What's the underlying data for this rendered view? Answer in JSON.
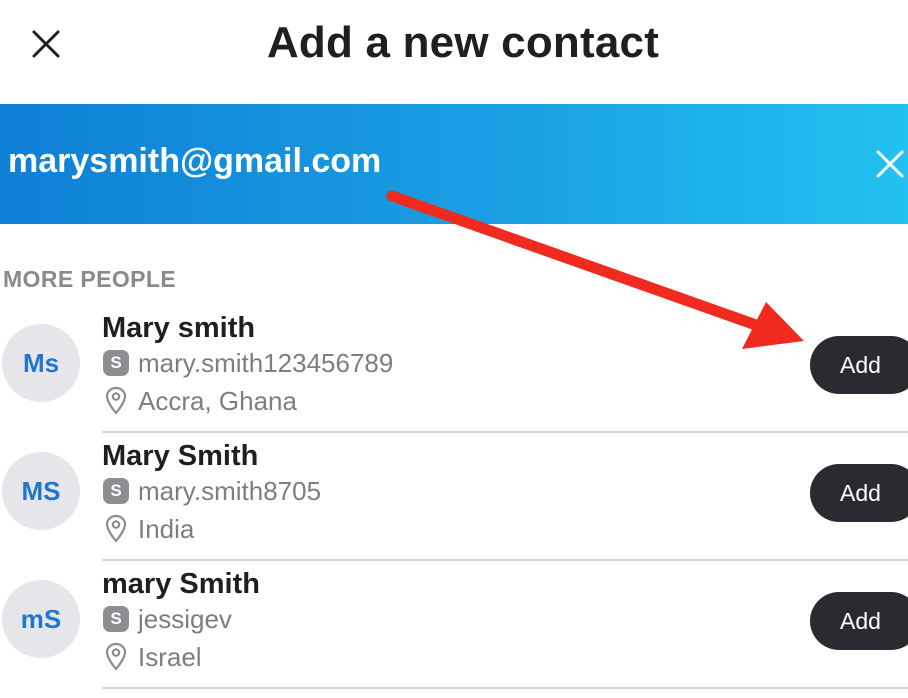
{
  "header": {
    "title": "Add a new contact"
  },
  "search": {
    "value": "marysmith@gmail.com"
  },
  "section": {
    "heading": "MORE PEOPLE"
  },
  "contacts": [
    {
      "initials": "Ms",
      "name": "Mary smith",
      "username": "mary.smith123456789",
      "location": "Accra, Ghana",
      "add_label": "Add"
    },
    {
      "initials": "MS",
      "name": "Mary Smith",
      "username": "mary.smith8705",
      "location": "India",
      "add_label": "Add"
    },
    {
      "initials": "mS",
      "name": "mary Smith",
      "username": "jessigev",
      "location": "Israel",
      "add_label": "Add"
    }
  ],
  "icons": {
    "close": "close-icon",
    "clear": "clear-icon",
    "skype": "skype-icon",
    "location": "location-pin-icon"
  },
  "colors": {
    "accent_start": "#0f7fd6",
    "accent_end": "#22c1ef",
    "avatar_text": "#1f76d2",
    "button_bg": "#2a2b30",
    "annotation_arrow": "#f02a1e"
  }
}
